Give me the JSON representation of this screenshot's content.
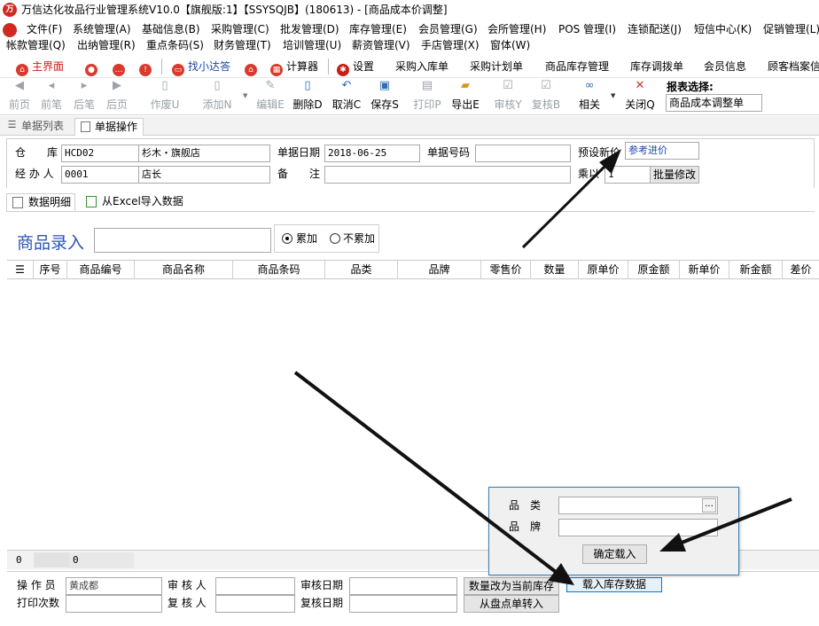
{
  "app": {
    "title": "万信达化妆品行业管理系统V10.0【旗舰版:1】【SSYSQJB】(180613) - [商品成本价调整]",
    "logo_text": "万"
  },
  "menu": {
    "row1": [
      "文件(F)",
      "系统管理(A)",
      "基础信息(B)",
      "采购管理(C)",
      "批发管理(D)",
      "库存管理(E)",
      "会员管理(G)",
      "会所管理(H)",
      "POS 管理(I)",
      "连锁配送(J)",
      "短信中心(K)",
      "促销管理(L)"
    ],
    "row2": [
      "帐款管理(Q)",
      "出纳管理(R)",
      "重点条码(S)",
      "财务管理(T)",
      "培训管理(U)",
      "薪资管理(V)",
      "手店管理(X)",
      "窗体(W)"
    ]
  },
  "quickbar": {
    "main": "主界面",
    "xiaoda": "找小达答",
    "calculator": "计算器",
    "settings": "设置",
    "purchase_in": "采购入库单",
    "purchase_plan": "采购计划单",
    "inventory_mgmt": "商品库存管理",
    "transfer": "库存调拨单",
    "member_info": "会员信息",
    "customer_files": "顾客档案信"
  },
  "toolbar": {
    "first": "前页",
    "prev": "前笔",
    "next": "后笔",
    "last": "后页",
    "void": "作废U",
    "add": "添加N",
    "edit": "编辑E",
    "delete": "删除D",
    "cancel": "取消C",
    "save": "保存S",
    "print": "打印P",
    "export": "导出E",
    "audit": "审核Y",
    "recheck": "复核B",
    "related": "相关",
    "close": "关闭Q",
    "report_label": "报表选择:",
    "report_value": "商品成本调整单"
  },
  "tabs": {
    "list": "单据列表",
    "operation": "单据操作"
  },
  "form": {
    "warehouse_label": "仓　　库",
    "warehouse_code": "HCD02",
    "warehouse_name": "杉木・旗舰店",
    "date_label": "单据日期",
    "date_value": "2018-06-25",
    "docno_label": "单据号码",
    "docno_value": "",
    "preset_label": "预设新价",
    "preset_value": "参考进价",
    "handler_label": "经 办 人",
    "handler_code": "0001",
    "handler_name": "店长",
    "remark_label": "备　　注",
    "remark_value": "",
    "multiply_label": "乘以",
    "multiply_value": "1",
    "batch_btn": "批量修改"
  },
  "subtabs": {
    "detail": "数据明细",
    "import_excel": "从Excel导入数据"
  },
  "entry": {
    "label": "商品录入",
    "value": "",
    "radio_accum": "累加",
    "radio_no_accum": "不累加",
    "accum_selected": true
  },
  "grid": {
    "columns": [
      "序号",
      "商品编号",
      "商品名称",
      "商品条码",
      "品类",
      "品牌",
      "零售价",
      "数量",
      "原单价",
      "原金额",
      "新单价",
      "新金额",
      "差价"
    ],
    "rows": [],
    "footer_count": "0",
    "footer_qty": "0"
  },
  "bottom": {
    "operator_label": "操 作 员",
    "operator_value": "黄成都",
    "auditor_label": "审 核 人",
    "auditor_value": "",
    "audit_date_label": "审核日期",
    "audit_date_value": "",
    "print_count_label": "打印次数",
    "print_count_value": "",
    "rechecker_label": "复 核 人",
    "rechecker_value": "",
    "recheck_date_label": "复核日期",
    "recheck_date_value": "",
    "btn_qty_to_stock": "数量改为当前库存",
    "btn_load_stock": "载入库存数据",
    "btn_from_stocktake": "从盘点单转入"
  },
  "popup": {
    "category_label": "品　类",
    "category_value": "",
    "brand_label": "品　牌",
    "brand_value": "",
    "browse_btn": "...",
    "confirm_btn": "确定载入"
  },
  "colors": {
    "accent_red": "#d02a20",
    "link_blue": "#1d46a8",
    "arrow": "#111111"
  }
}
